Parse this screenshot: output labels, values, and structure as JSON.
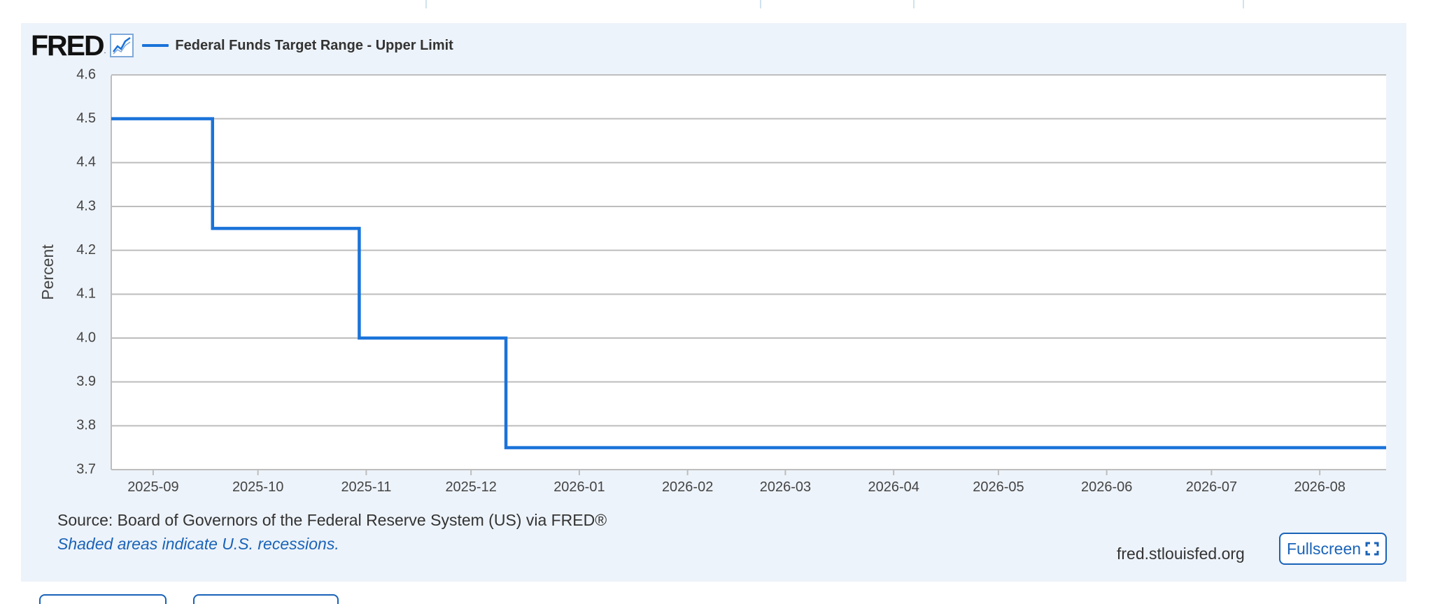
{
  "header": {
    "logo_text": "FRED",
    "logo_mark": ".",
    "icon": "line-chart-icon"
  },
  "colors": {
    "series": "#1a73d9",
    "panel_background": "#edf3fa",
    "grid": "#bdbdbd",
    "link": "#1a63b8"
  },
  "chart_data": {
    "type": "line",
    "step": true,
    "title": "",
    "xlabel": "",
    "ylabel": "Percent",
    "ylim": [
      3.7,
      4.6
    ],
    "yticks": [
      "3.7",
      "3.8",
      "3.9",
      "4.0",
      "4.1",
      "4.2",
      "4.3",
      "4.4",
      "4.5",
      "4.6"
    ],
    "xlim": [
      "2025-08-20",
      "2026-08-20"
    ],
    "xticks": [
      "2025-09",
      "2025-10",
      "2025-11",
      "2025-12",
      "2026-01",
      "2026-02",
      "2026-03",
      "2026-04",
      "2026-05",
      "2026-06",
      "2026-07",
      "2026-08"
    ],
    "grid": true,
    "legend": "top-left",
    "series": [
      {
        "name": "Federal Funds Target Range - Upper Limit",
        "x": [
          "2025-08-20",
          "2025-09-18",
          "2025-10-30",
          "2025-12-11",
          "2026-08-20"
        ],
        "values": [
          4.5,
          4.25,
          4.0,
          3.75,
          3.75
        ]
      }
    ]
  },
  "footer": {
    "source": "Source: Board of Governors of the Federal Reserve System (US) via FRED®",
    "recession_note": "Shaded areas indicate U.S. recessions.",
    "site": "fred.stlouisfed.org",
    "fullscreen_label": "Fullscreen"
  }
}
